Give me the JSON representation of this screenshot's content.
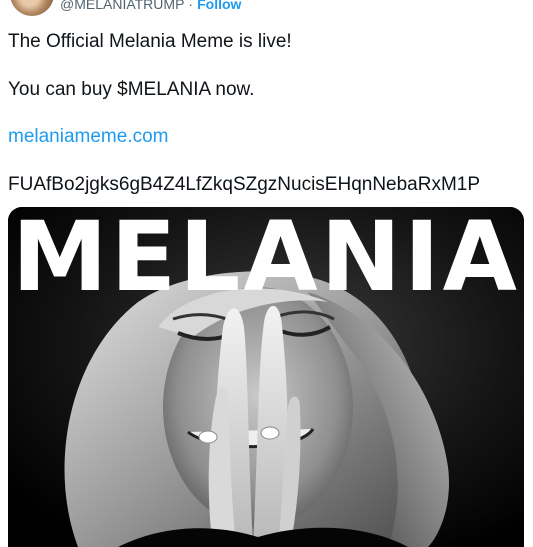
{
  "header": {
    "handle": "@MELANIATRUMP",
    "separator": "·",
    "follow_label": "Follow"
  },
  "tweet": {
    "line1": "The Official Melania Meme is live!",
    "line2": "You can buy $MELANIA now.",
    "link": "melaniameme.com",
    "contract": "FUAfBo2jgks6gB4Z4LfZkqSZgzNucisEHqnNebaRxM1P"
  },
  "media": {
    "title": "MELANIA"
  },
  "colors": {
    "link": "#1d9bf0",
    "muted": "#536471",
    "text": "#0f1419"
  }
}
